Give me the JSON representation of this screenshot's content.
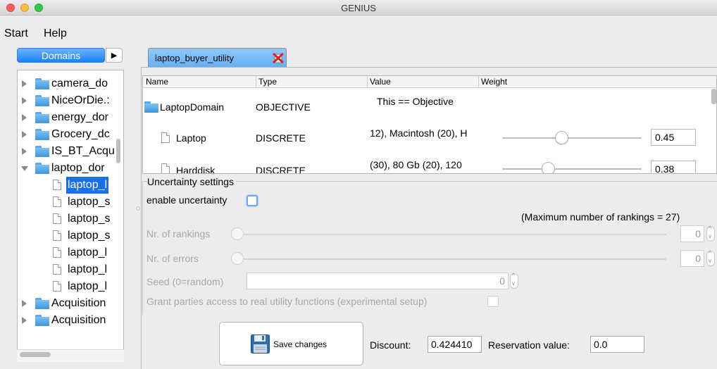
{
  "window": {
    "title": "GENIUS"
  },
  "menu": [
    "Start",
    "Help"
  ],
  "domains": {
    "button_label": "Domains",
    "tree": [
      {
        "label": "camera_do",
        "type": "folder",
        "expanded": false
      },
      {
        "label": "NiceOrDie.:",
        "type": "folder",
        "expanded": false
      },
      {
        "label": "energy_dor",
        "type": "folder",
        "expanded": false
      },
      {
        "label": "Grocery_dc",
        "type": "folder",
        "expanded": false
      },
      {
        "label": "IS_BT_Acqu",
        "type": "folder",
        "expanded": false
      },
      {
        "label": "laptop_dor",
        "type": "folder",
        "expanded": true
      },
      {
        "label": "laptop_l",
        "type": "file",
        "selected": true
      },
      {
        "label": "laptop_s",
        "type": "file"
      },
      {
        "label": "laptop_s",
        "type": "file"
      },
      {
        "label": "laptop_s",
        "type": "file"
      },
      {
        "label": "laptop_l",
        "type": "file"
      },
      {
        "label": "laptop_l",
        "type": "file"
      },
      {
        "label": "laptop_l",
        "type": "file"
      },
      {
        "label": "Acquisition",
        "type": "folder",
        "expanded": false
      },
      {
        "label": "Acquisition",
        "type": "folder",
        "expanded": false
      }
    ]
  },
  "editor": {
    "tab_label": "laptop_buyer_utility",
    "columns": [
      "Name",
      "Type",
      "Value",
      "Weight"
    ],
    "rows": [
      {
        "name": "LaptopDomain",
        "type": "OBJECTIVE",
        "value": "This == Objective",
        "weight": null
      },
      {
        "name": "Laptop",
        "type": "DISCRETE",
        "value": "12), Macintosh (20), H",
        "weight": "0.45"
      },
      {
        "name": "Harddisk",
        "type": "DISCRETE",
        "value": "(30), 80 Gb (20), 120",
        "weight": "0.38"
      }
    ],
    "uncertainty": {
      "group_title": "Uncertainty settings",
      "enable_label": "enable uncertainty",
      "max_rankings_text": "(Maximum number of rankings = 27)",
      "rankings_label": "Nr. of rankings",
      "rankings_value": "0",
      "errors_label": "Nr. of errors",
      "errors_value": "0",
      "seed_label": "Seed (0=random)",
      "seed_value": "0",
      "grant_label": "Grant parties access to real utility functions (experimental setup)"
    },
    "save_label": "Save changes",
    "discount_label": "Discount:",
    "discount_value": "0.424410",
    "reservation_label": "Reservation value:",
    "reservation_value": "0.0"
  },
  "colors": {
    "accent": "#1a82fb",
    "selection": "#1a6ef0",
    "tab": "#7dbcf7"
  }
}
